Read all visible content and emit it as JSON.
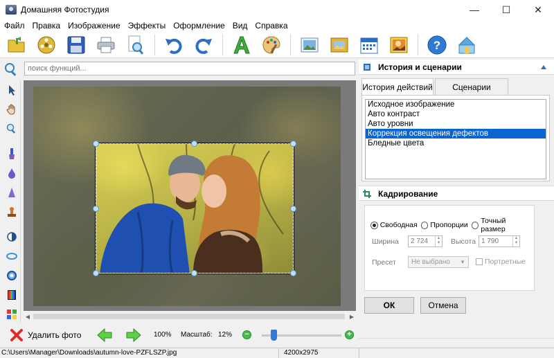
{
  "window": {
    "title": "Домашняя Фотостудия",
    "minimize": "—",
    "maximize": "☐",
    "close": "✕"
  },
  "menu": [
    "Файл",
    "Правка",
    "Изображение",
    "Эффекты",
    "Оформление",
    "Вид",
    "Справка"
  ],
  "search": {
    "placeholder": "поиск функций...",
    "value": ""
  },
  "history_panel": {
    "title": "История и сценарии",
    "tabs": [
      "История действий",
      "Сценарии"
    ],
    "active_tab": "История действий",
    "items": [
      "Исходное изображение",
      "Авто контраст",
      "Авто уровни",
      "Коррекция освещения дефектов",
      "Бледные цвета"
    ],
    "selected_index": 3
  },
  "crop_panel": {
    "title": "Кадрирование",
    "modes": [
      "Свободная",
      "Пропорции",
      "Точный размер"
    ],
    "selected_mode": "Свободная",
    "width_label": "Ширина",
    "width_value": "2 724",
    "height_label": "Высота",
    "height_value": "1 790",
    "preset_label": "Пресет",
    "preset_value": "Не выбрано",
    "portrait_label": "Портретные",
    "portrait_checked": false,
    "ok_label": "ОК",
    "cancel_label": "Отмена"
  },
  "bottom_bar": {
    "delete_label": "Удалить фото",
    "zoom_100": "100%",
    "scale_label": "Масштаб:",
    "scale_value": "12%",
    "zoom_slider_level": 0.12
  },
  "status": {
    "path": "C:\\Users\\Manager\\Downloads\\autumn-love-PZFLSZP.jpg",
    "dimensions": "4200x2975"
  },
  "colors": {
    "selection": "#0a64d2",
    "accent_green": "#3fbf4a",
    "slider": "#2f7ad4"
  },
  "icons": {
    "toolbar": [
      "open-folder-icon",
      "film-reel-icon",
      "save-icon",
      "print-icon",
      "preview-icon",
      "undo-icon",
      "redo-icon",
      "text-icon",
      "palette-icon",
      "gallery-icon",
      "frame-icon",
      "calendar-icon",
      "postcard-icon",
      "help-icon",
      "home-icon"
    ],
    "tools": [
      "pointer-icon",
      "hand-icon",
      "zoom-icon",
      "brush-icon",
      "drop-icon",
      "sharpen-icon",
      "stamp-icon",
      "contrast-icon",
      "rotate-icon",
      "circle-icon",
      "levels-icon",
      "effects-icon"
    ]
  }
}
